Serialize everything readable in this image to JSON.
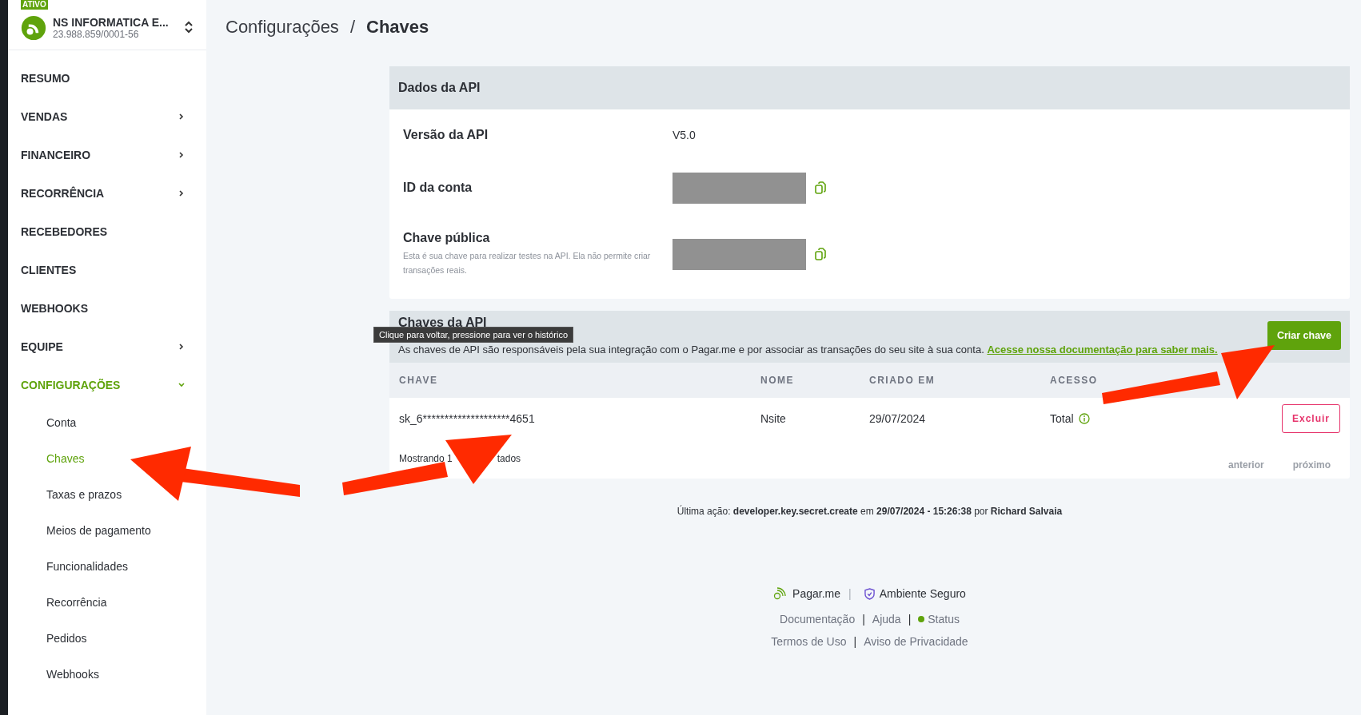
{
  "sidebar": {
    "status_badge": "ATIVO",
    "company": "NS INFORMATICA E...",
    "document": "23.988.859/0001-56",
    "items": [
      {
        "label": "RESUMO",
        "kind": "link",
        "selected": false
      },
      {
        "label": "VENDAS",
        "kind": "group",
        "expanded": false,
        "selected": false
      },
      {
        "label": "FINANCEIRO",
        "kind": "group",
        "expanded": false,
        "selected": false
      },
      {
        "label": "RECORRÊNCIA",
        "kind": "group",
        "expanded": false,
        "selected": false
      },
      {
        "label": "RECEBEDORES",
        "kind": "link",
        "selected": false
      },
      {
        "label": "CLIENTES",
        "kind": "link",
        "selected": false
      },
      {
        "label": "WEBHOOKS",
        "kind": "link",
        "selected": false
      },
      {
        "label": "EQUIPE",
        "kind": "group",
        "expanded": false,
        "selected": false
      },
      {
        "label": "CONFIGURAÇÕES",
        "kind": "group",
        "expanded": true,
        "selected": true,
        "children": [
          {
            "label": "Conta",
            "selected": false
          },
          {
            "label": "Chaves",
            "selected": true
          },
          {
            "label": "Taxas e prazos",
            "selected": false
          },
          {
            "label": "Meios de pagamento",
            "selected": false
          },
          {
            "label": "Funcionalidades",
            "selected": false
          },
          {
            "label": "Recorrência",
            "selected": false
          },
          {
            "label": "Pedidos",
            "selected": false
          },
          {
            "label": "Webhooks",
            "selected": false
          }
        ]
      }
    ]
  },
  "breadcrumb": {
    "parent": "Configurações",
    "separator": "/",
    "current": "Chaves"
  },
  "api_data": {
    "title": "Dados da API",
    "rows": [
      {
        "label": "Versão da API",
        "kind": "text",
        "value": "V5.0"
      },
      {
        "label": "ID da conta",
        "kind": "masked"
      },
      {
        "label": "Chave pública",
        "kind": "masked",
        "description": "Esta é sua chave para realizar testes na API. Ela não permite criar transações reais."
      }
    ]
  },
  "api_keys": {
    "title": "Chaves da API",
    "description": "As chaves de API são responsáveis pela sua integração com o Pagar.me e por associar as transações do seu site à sua conta.",
    "link": "Acesse nossa documentação para saber mais.",
    "create_button": "Criar chave",
    "columns": [
      "CHAVE",
      "NOME",
      "CRIADO EM",
      "ACESSO"
    ],
    "rows": [
      {
        "key": "sk_6********************4651",
        "name": "Nsite",
        "created": "29/07/2024",
        "access": "Total",
        "action": "Excluir"
      }
    ],
    "showing": [
      "Mostrando 1",
      "tados"
    ],
    "pagination": [
      {
        "label": "anterior",
        "disabled": true
      },
      {
        "label": "próximo",
        "disabled": true
      }
    ]
  },
  "tooltip": "Clique para voltar, pressione para ver o histórico",
  "last_action": "Última ação: **developer.key.secret.create** em **29/07/2024 - 15:26:38** por **Richard Salvaia**",
  "footer": {
    "brand": "Pagar.me",
    "brand_separator": "|",
    "secure": "Ambiente Seguro",
    "lines": [
      [
        {
          "kind": "link",
          "label": "Documentação"
        },
        {
          "kind": "sep",
          "label": "|"
        },
        {
          "kind": "link",
          "label": "Ajuda"
        },
        {
          "kind": "sep",
          "label": "|"
        },
        {
          "kind": "status",
          "label": "Status"
        }
      ],
      [
        {
          "kind": "link",
          "label": "Termos de Uso"
        },
        {
          "kind": "sep",
          "label": "|"
        },
        {
          "kind": "link",
          "label": "Aviso de Privacidade"
        }
      ]
    ]
  }
}
